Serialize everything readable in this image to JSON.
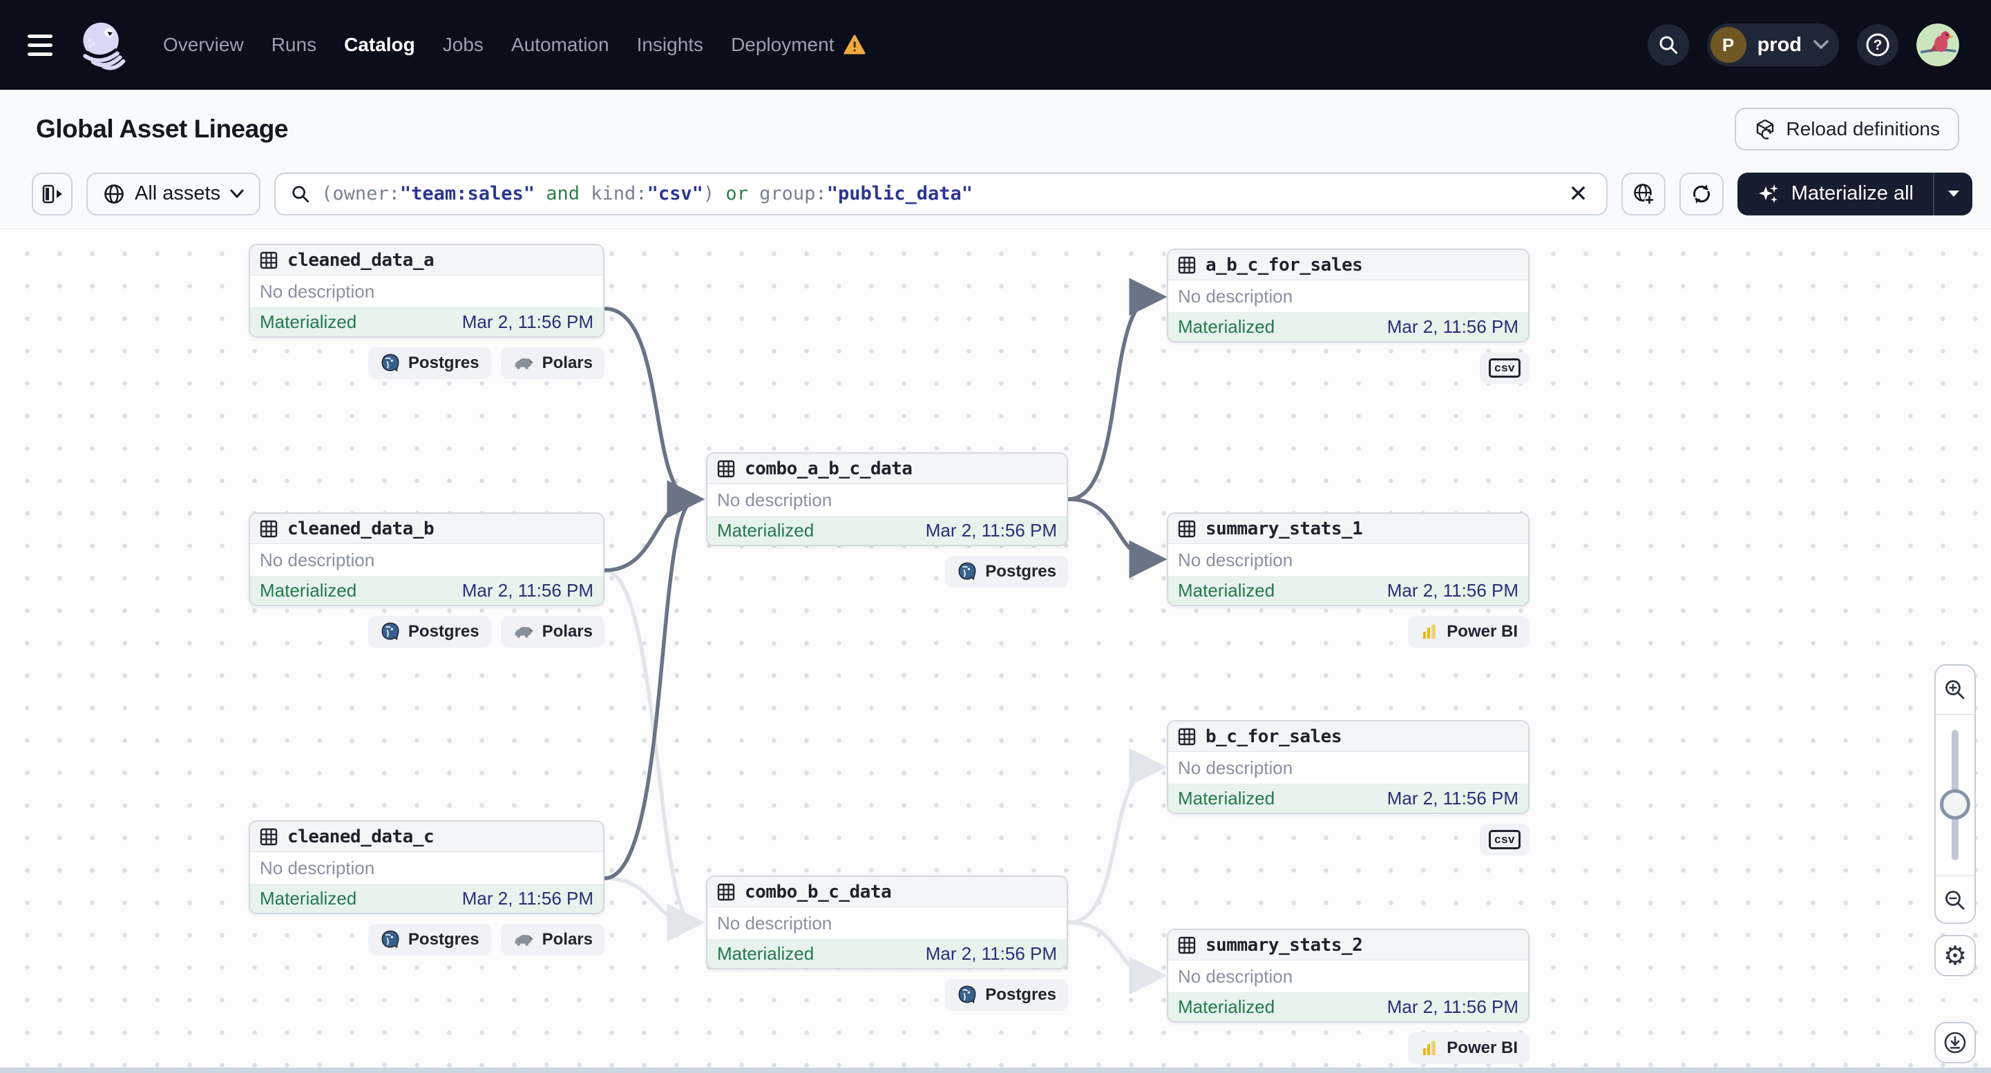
{
  "colors": {
    "nav_bg": "#0A0D1A",
    "accent_navy": "#2B3690",
    "keyword_green": "#2F7E4E",
    "status_green_text": "#24784F",
    "status_green_bg": "#E7F3EC",
    "timestamp_navy": "#2A2E78",
    "edge_dark": "#6B7485",
    "edge_light": "#E2E5EA",
    "warning_orange": "#F2A93C",
    "powerbi_yellow": "#E7B70C",
    "postgres_blue": "#39618E"
  },
  "icons": {
    "menu": "hamburger-icon",
    "logo": "dagster-octopus-logo",
    "deployment_warning": "warning-triangle-icon",
    "search": "magnifier-icon",
    "help_glyph": "?",
    "scope_globe": "globe-icon",
    "clear_glyph": "×",
    "add_scope": "globe-plus-icon",
    "refresh": "refresh-icon",
    "materialize_sparkle": "sparkle-icon",
    "reload": "cube-reload-icon",
    "asset": "table-grid-icon",
    "zoom_in": "magnifier-plus-icon",
    "zoom_out": "magnifier-minus-icon",
    "settings": "gear-icon",
    "download": "download-circle-icon"
  },
  "nav": {
    "items": [
      {
        "label": "Overview",
        "active": false
      },
      {
        "label": "Runs",
        "active": false
      },
      {
        "label": "Catalog",
        "active": true
      },
      {
        "label": "Jobs",
        "active": false
      },
      {
        "label": "Automation",
        "active": false
      },
      {
        "label": "Insights",
        "active": false
      },
      {
        "label": "Deployment",
        "active": false,
        "warning": true
      }
    ],
    "environment": {
      "initial": "P",
      "name": "prod"
    },
    "help_glyph": "?"
  },
  "header": {
    "title": "Global Asset Lineage",
    "reload_button": "Reload definitions"
  },
  "toolbar": {
    "scope_button": "All assets",
    "query_segments": [
      {
        "text": "(owner:",
        "tone": "plain"
      },
      {
        "text": "\"team:sales\"",
        "tone": "value"
      },
      {
        "text": " ",
        "tone": "plain"
      },
      {
        "text": "and",
        "tone": "keyword"
      },
      {
        "text": " kind:",
        "tone": "plain"
      },
      {
        "text": "\"csv\"",
        "tone": "value"
      },
      {
        "text": ") ",
        "tone": "plain"
      },
      {
        "text": "or",
        "tone": "keyword"
      },
      {
        "text": " group:",
        "tone": "plain"
      },
      {
        "text": "\"public_data\"",
        "tone": "value"
      }
    ],
    "materialize_button": "Materialize all"
  },
  "graph": {
    "nodes": [
      {
        "name": "cleaned_data_a",
        "description": "No description",
        "status": "Materialized",
        "timestamp": "Mar 2, 11:56 PM",
        "tags": [
          {
            "label": "Postgres"
          },
          {
            "label": "Polars"
          }
        ]
      },
      {
        "name": "cleaned_data_b",
        "description": "No description",
        "status": "Materialized",
        "timestamp": "Mar 2, 11:56 PM",
        "tags": [
          {
            "label": "Postgres"
          },
          {
            "label": "Polars"
          }
        ]
      },
      {
        "name": "cleaned_data_c",
        "description": "No description",
        "status": "Materialized",
        "timestamp": "Mar 2, 11:56 PM",
        "tags": [
          {
            "label": "Postgres"
          },
          {
            "label": "Polars"
          }
        ]
      },
      {
        "name": "combo_a_b_c_data",
        "description": "No description",
        "status": "Materialized",
        "timestamp": "Mar 2, 11:56 PM",
        "tags": [
          {
            "label": "Postgres"
          }
        ]
      },
      {
        "name": "combo_b_c_data",
        "description": "No description",
        "status": "Materialized",
        "timestamp": "Mar 2, 11:56 PM",
        "tags": [
          {
            "label": "Postgres"
          }
        ]
      },
      {
        "name": "a_b_c_for_sales",
        "description": "No description",
        "status": "Materialized",
        "timestamp": "Mar 2, 11:56 PM",
        "tags": [
          {
            "label": "csv"
          }
        ]
      },
      {
        "name": "summary_stats_1",
        "description": "No description",
        "status": "Materialized",
        "timestamp": "Mar 2, 11:56 PM",
        "tags": [
          {
            "label": "Power BI"
          }
        ]
      },
      {
        "name": "b_c_for_sales",
        "description": "No description",
        "status": "Materialized",
        "timestamp": "Mar 2, 11:56 PM",
        "tags": [
          {
            "label": "csv"
          }
        ]
      },
      {
        "name": "summary_stats_2",
        "description": "No description",
        "status": "Materialized",
        "timestamp": "Mar 2, 11:56 PM",
        "tags": [
          {
            "label": "Power BI"
          }
        ]
      }
    ],
    "edges": [
      {
        "from": "cleaned_data_a",
        "to": "combo_a_b_c_data",
        "emphasis": "dark"
      },
      {
        "from": "cleaned_data_b",
        "to": "combo_a_b_c_data",
        "emphasis": "dark"
      },
      {
        "from": "cleaned_data_c",
        "to": "combo_a_b_c_data",
        "emphasis": "dark"
      },
      {
        "from": "combo_a_b_c_data",
        "to": "a_b_c_for_sales",
        "emphasis": "dark"
      },
      {
        "from": "combo_a_b_c_data",
        "to": "summary_stats_1",
        "emphasis": "dark"
      },
      {
        "from": "cleaned_data_b",
        "to": "combo_b_c_data",
        "emphasis": "light"
      },
      {
        "from": "cleaned_data_c",
        "to": "combo_b_c_data",
        "emphasis": "light"
      },
      {
        "from": "combo_b_c_data",
        "to": "b_c_for_sales",
        "emphasis": "light"
      },
      {
        "from": "combo_b_c_data",
        "to": "summary_stats_2",
        "emphasis": "light"
      }
    ]
  }
}
